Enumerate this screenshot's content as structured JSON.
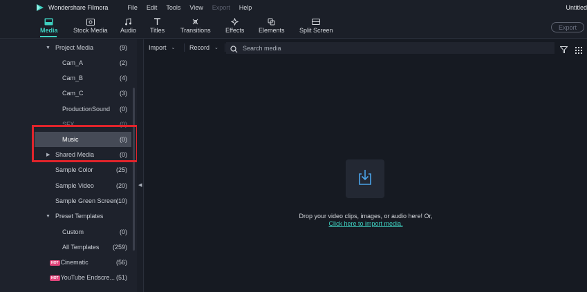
{
  "app": {
    "name": "Wondershare Filmora",
    "window_title": "Untitled"
  },
  "menu": [
    {
      "label": "File",
      "enabled": true
    },
    {
      "label": "Edit",
      "enabled": true
    },
    {
      "label": "Tools",
      "enabled": true
    },
    {
      "label": "View",
      "enabled": true
    },
    {
      "label": "Export",
      "enabled": false
    },
    {
      "label": "Help",
      "enabled": true
    }
  ],
  "toolbar": {
    "tabs": [
      {
        "label": "Media",
        "icon": "media-icon",
        "active": true
      },
      {
        "label": "Stock Media",
        "icon": "stock-media-icon",
        "active": false
      },
      {
        "label": "Audio",
        "icon": "audio-icon",
        "active": false
      },
      {
        "label": "Titles",
        "icon": "titles-icon",
        "active": false
      },
      {
        "label": "Transitions",
        "icon": "transitions-icon",
        "active": false
      },
      {
        "label": "Effects",
        "icon": "effects-icon",
        "active": false
      },
      {
        "label": "Elements",
        "icon": "elements-icon",
        "active": false
      },
      {
        "label": "Split Screen",
        "icon": "split-screen-icon",
        "active": false
      }
    ],
    "export_label": "Export",
    "accent_color": "#3fd0c0"
  },
  "sidebar": {
    "items": [
      {
        "label": "Project Media",
        "count": "(9)",
        "expanded": true
      },
      {
        "label": "Cam_A",
        "count": "(2)"
      },
      {
        "label": "Cam_B",
        "count": "(4)"
      },
      {
        "label": "Cam_C",
        "count": "(3)"
      },
      {
        "label": "ProductionSound",
        "count": "(0)"
      },
      {
        "label": "SFX",
        "count": "(0)"
      },
      {
        "label": "Music",
        "count": "(0)",
        "selected": true
      },
      {
        "label": "Shared Media",
        "count": "(0)",
        "expanded": false
      },
      {
        "label": "Sample Color",
        "count": "(25)"
      },
      {
        "label": "Sample Video",
        "count": "(20)"
      },
      {
        "label": "Sample Green Screen",
        "count": "(10)"
      },
      {
        "label": "Preset Templates",
        "count": "",
        "expanded": true
      },
      {
        "label": "Custom",
        "count": "(0)"
      },
      {
        "label": "All Templates",
        "count": "(259)"
      },
      {
        "label": "Cinematic",
        "count": "(56)",
        "badge": "HOT"
      },
      {
        "label": "YouTube Endscre...",
        "count": "(51)",
        "badge": "HOT"
      }
    ]
  },
  "main": {
    "import_label": "Import",
    "record_label": "Record",
    "search_placeholder": "Search media",
    "drop_text": "Drop your video clips, images, or audio here! Or,",
    "import_link": "Click here to import media."
  }
}
